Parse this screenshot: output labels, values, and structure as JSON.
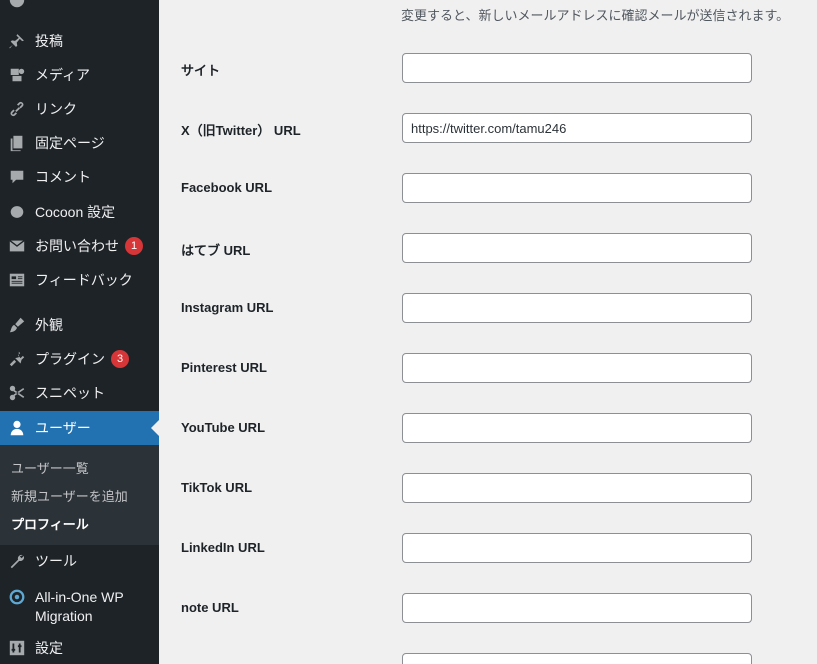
{
  "sidebar": {
    "items": [
      {
        "label": "投稿",
        "icon": "pin-icon"
      },
      {
        "label": "メディア",
        "icon": "media-icon"
      },
      {
        "label": "リンク",
        "icon": "link-icon"
      },
      {
        "label": "固定ページ",
        "icon": "page-icon"
      },
      {
        "label": "コメント",
        "icon": "comment-icon"
      },
      {
        "label": "Cocoon 設定",
        "icon": "circle-icon"
      },
      {
        "label": "お問い合わせ",
        "icon": "mail-icon",
        "badge": "1"
      },
      {
        "label": "フィードバック",
        "icon": "feedback-icon"
      },
      {
        "label": "外観",
        "icon": "brush-icon"
      },
      {
        "label": "プラグイン",
        "icon": "plugin-icon",
        "badge": "3"
      },
      {
        "label": "スニペット",
        "icon": "scissors-icon"
      },
      {
        "label": "ユーザー",
        "icon": "user-icon"
      },
      {
        "label": "ツール",
        "icon": "wrench-icon"
      },
      {
        "label": "All-in-One WP Migration",
        "icon": "migration-icon"
      },
      {
        "label": "設定",
        "icon": "settings-icon"
      }
    ],
    "submenu": [
      "ユーザー一覧",
      "新規ユーザーを追加",
      "プロフィール"
    ]
  },
  "main": {
    "description": "変更すると、新しいメールアドレスに確認メールが送信されます。",
    "fields": [
      {
        "label": "サイト",
        "value": ""
      },
      {
        "label": "X（旧Twitter） URL",
        "value": "https://twitter.com/tamu246"
      },
      {
        "label": "Facebook URL",
        "value": ""
      },
      {
        "label": "はてブ URL",
        "value": ""
      },
      {
        "label": "Instagram URL",
        "value": ""
      },
      {
        "label": "Pinterest URL",
        "value": ""
      },
      {
        "label": "YouTube URL",
        "value": ""
      },
      {
        "label": "TikTok URL",
        "value": ""
      },
      {
        "label": "LinkedIn URL",
        "value": ""
      },
      {
        "label": "note URL",
        "value": ""
      }
    ]
  },
  "colors": {
    "sidebar_bg": "#1d2327",
    "submenu_bg": "#2c3338",
    "accent": "#2271b1",
    "badge": "#d63638",
    "content_bg": "#f0f0f1"
  }
}
